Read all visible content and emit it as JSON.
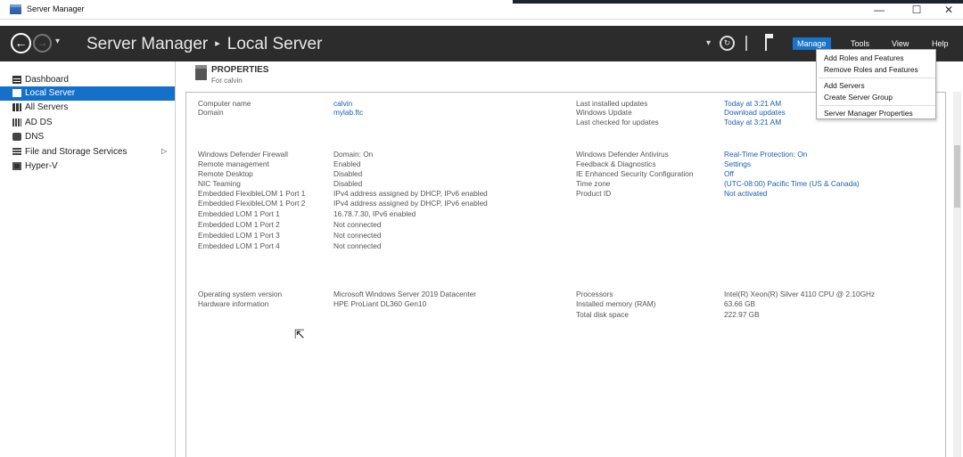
{
  "window": {
    "title": "Server Manager",
    "minimize": "—",
    "maximize": "☐",
    "close": "✕"
  },
  "toolbar": {
    "breadcrumb_root": "Server Manager",
    "breadcrumb_sep": "▸",
    "breadcrumb_page": "Local Server",
    "menu": {
      "manage": "Manage",
      "tools": "Tools",
      "view": "View",
      "help": "Help"
    },
    "manage_menu": {
      "add_roles": "Add Roles and Features",
      "remove_roles": "Remove Roles and Features",
      "add_servers": "Add Servers",
      "create_group": "Create Server Group",
      "properties": "Server Manager Properties"
    }
  },
  "sidebar": {
    "items": [
      {
        "label": "Dashboard",
        "icon": "dashboard-icon"
      },
      {
        "label": "Local Server",
        "icon": "local-server-icon"
      },
      {
        "label": "All Servers",
        "icon": "all-servers-icon"
      },
      {
        "label": "AD DS",
        "icon": "ad-ds-icon"
      },
      {
        "label": "DNS",
        "icon": "dns-icon"
      },
      {
        "label": "File and Storage Services",
        "icon": "storage-icon"
      },
      {
        "label": "Hyper-V",
        "icon": "hyper-v-icon"
      }
    ],
    "expand_arrow": "▷"
  },
  "properties": {
    "title": "PROPERTIES",
    "subtitle": "For calvin",
    "left1": [
      {
        "label": "Computer name",
        "value": "calvin"
      },
      {
        "label": "Domain",
        "value": "mylab.ftc"
      }
    ],
    "right1": [
      {
        "label": "Last installed updates",
        "value": "Today at 3:21 AM"
      },
      {
        "label": "Windows Update",
        "value": "Download updates"
      },
      {
        "label": "Last checked for updates",
        "value": "Today at 3:21 AM"
      }
    ],
    "left2": [
      {
        "label": "Windows Defender Firewall",
        "value": "Domain: On"
      },
      {
        "label": "Remote management",
        "value": "Enabled"
      },
      {
        "label": "Remote Desktop",
        "value": "Disabled"
      },
      {
        "label": "NIC Teaming",
        "value": "Disabled"
      },
      {
        "label": "Embedded FlexibleLOM 1 Port 1",
        "value": "IPv4 address assigned by DHCP, IPv6 enabled"
      },
      {
        "label": "Embedded FlexibleLOM 1 Port 2",
        "value": "IPv4 address assigned by DHCP, IPv6 enabled"
      },
      {
        "label": "Embedded LOM 1 Port 1",
        "value": "16.78.7.30, IPv6 enabled"
      },
      {
        "label": "Embedded LOM 1 Port 2",
        "value": "Not connected"
      },
      {
        "label": "Embedded LOM 1 Port 3",
        "value": "Not connected"
      },
      {
        "label": "Embedded LOM 1 Port 4",
        "value": "Not connected"
      }
    ],
    "right2": [
      {
        "label": "Windows Defender Antivirus",
        "value": "Real-Time Protection: On"
      },
      {
        "label": "Feedback & Diagnostics",
        "value": "Settings"
      },
      {
        "label": "IE Enhanced Security Configuration",
        "value": "Off"
      },
      {
        "label": "Time zone",
        "value": "(UTC-08:00) Pacific Time (US & Canada)"
      },
      {
        "label": "Product ID",
        "value": "Not activated"
      }
    ],
    "left3": [
      {
        "label": "Operating system version",
        "value": "Microsoft Windows Server 2019 Datacenter"
      },
      {
        "label": "Hardware information",
        "value": "HPE ProLiant DL360 Gen10"
      }
    ],
    "right3": [
      {
        "label": "Processors",
        "value": "Intel(R) Xeon(R) Silver 4110 CPU @ 2.10GHz"
      },
      {
        "label": "Installed memory (RAM)",
        "value": "63.66 GB"
      },
      {
        "label": "Total disk space",
        "value": "222.97 GB"
      }
    ]
  },
  "colors": {
    "toolbar": "#2c2c2c",
    "accent": "#1470c9",
    "link": "#1a5fb0"
  }
}
